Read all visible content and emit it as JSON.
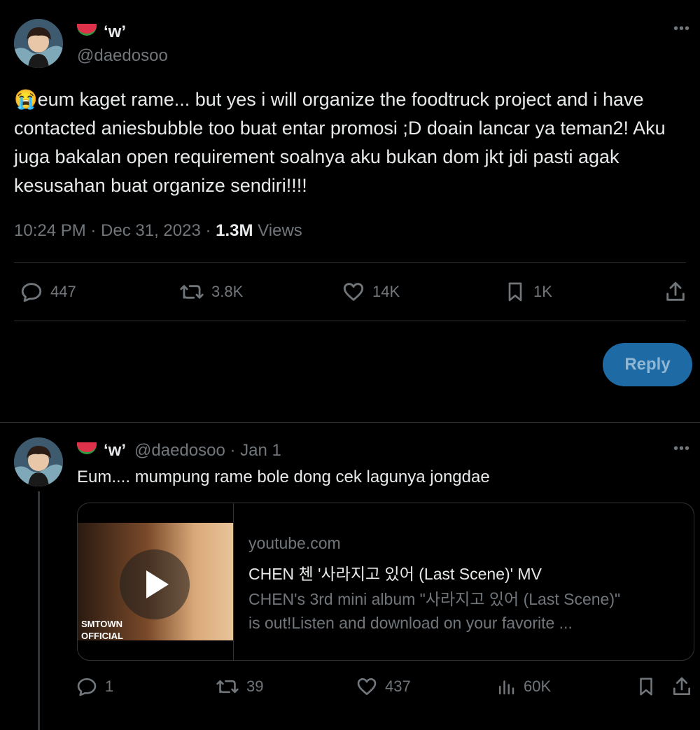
{
  "main_tweet": {
    "display_name": "‘w’",
    "handle": "@daedosoo",
    "text": "eum kaget rame... but yes i will organize the foodtruck project and i have contacted aniesbubble too buat entar promosi ;D doain lancar ya teman2! Aku juga bakalan open requirement soalnya aku bukan dom jkt jdi pasti agak kesusahan buat organize sendiri!!!!",
    "emoji": "😭",
    "time": "10:24 PM · Dec 31, 2023 · ",
    "views_count": "1.3M",
    "views_label": " Views",
    "actions": {
      "replies": "447",
      "retweets": "3.8K",
      "likes": "14K",
      "bookmarks": "1K"
    }
  },
  "reply_button": {
    "label": "Reply"
  },
  "reply_tweet": {
    "display_name": "‘w’",
    "handle": "@daedosoo",
    "date": " · Jan 1",
    "text": "Eum.... mumpung rame bole dong cek lagunya jongdae",
    "card": {
      "domain": "youtube.com",
      "title": "CHEN 첸 '사라지고 있어 (Last Scene)' MV",
      "description_line1": "CHEN's 3rd mini album \"사라지고 있어 (Last Scene)\"",
      "description_line2": "is out!Listen and download on your favorite ...",
      "thumb_badge_line1": "SMTOWN",
      "thumb_badge_line2": "OFFICIAL"
    },
    "actions": {
      "replies": "1",
      "retweets": "39",
      "likes": "437",
      "views": "60K"
    }
  },
  "colors": {
    "background": "#000000",
    "text": "#e7e9ea",
    "muted": "#71767b",
    "reply_button": "#1d6aa5",
    "divider": "#2f3336"
  }
}
